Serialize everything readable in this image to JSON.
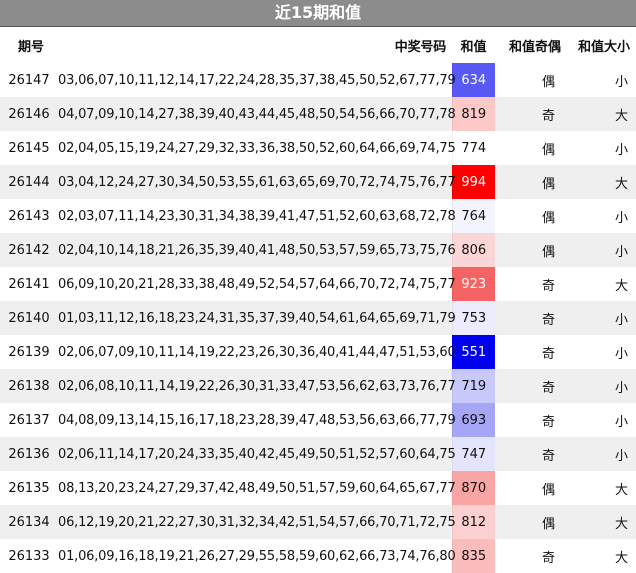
{
  "title": "近15期和值",
  "headers": {
    "issue": "期号",
    "numbers": "中奖号码",
    "sum": "和值",
    "odd_even": "和值奇偶",
    "big_small": "和值大小"
  },
  "colors": {
    "title_bg": "#8c8c8c",
    "low_extreme": "#0000ee",
    "high_extreme": "#ff0000"
  },
  "rows": [
    {
      "issue": "26147",
      "numbers": "03,06,07,10,11,12,14,17,22,24,28,35,37,38,45,50,52,67,77,79",
      "sum": "634",
      "odd_even": "偶",
      "big_small": "小",
      "sum_bg": "#5858f4",
      "sum_color": "#ffffff"
    },
    {
      "issue": "26146",
      "numbers": "04,07,09,10,14,27,38,39,40,43,44,45,48,50,54,56,66,70,77,78",
      "sum": "819",
      "odd_even": "奇",
      "big_small": "大",
      "sum_bg": "#fcc8c8",
      "sum_color": "#111111"
    },
    {
      "issue": "26145",
      "numbers": "02,04,05,15,19,24,27,29,32,33,36,38,50,52,60,64,66,69,74,75",
      "sum": "774",
      "odd_even": "偶",
      "big_small": "小",
      "sum_bg": "#ffffff",
      "sum_color": "#111111"
    },
    {
      "issue": "26144",
      "numbers": "03,04,12,24,27,30,34,50,53,55,61,63,65,69,70,72,74,75,76,77",
      "sum": "994",
      "odd_even": "偶",
      "big_small": "大",
      "sum_bg": "#ff0000",
      "sum_color": "#ffffff"
    },
    {
      "issue": "26143",
      "numbers": "02,03,07,11,14,23,30,31,34,38,39,41,47,51,52,60,63,68,72,78",
      "sum": "764",
      "odd_even": "偶",
      "big_small": "小",
      "sum_bg": "#f4f4fe",
      "sum_color": "#111111"
    },
    {
      "issue": "26142",
      "numbers": "02,04,10,14,18,21,26,35,39,40,41,48,50,53,57,59,65,73,75,76",
      "sum": "806",
      "odd_even": "偶",
      "big_small": "小",
      "sum_bg": "#fcd6d6",
      "sum_color": "#111111"
    },
    {
      "issue": "26141",
      "numbers": "06,09,10,20,21,28,33,38,48,49,52,54,57,64,66,70,72,74,75,77",
      "sum": "923",
      "odd_even": "奇",
      "big_small": "大",
      "sum_bg": "#f56464",
      "sum_color": "#ffffff"
    },
    {
      "issue": "26140",
      "numbers": "01,03,11,12,16,18,23,24,31,35,37,39,40,54,61,64,65,69,71,79",
      "sum": "753",
      "odd_even": "奇",
      "big_small": "小",
      "sum_bg": "#ececfd",
      "sum_color": "#111111"
    },
    {
      "issue": "26139",
      "numbers": "02,06,07,09,10,11,14,19,22,23,26,30,36,40,41,44,47,51,53,60",
      "sum": "551",
      "odd_even": "奇",
      "big_small": "小",
      "sum_bg": "#0000ee",
      "sum_color": "#ffffff"
    },
    {
      "issue": "26138",
      "numbers": "02,06,08,10,11,14,19,22,26,30,31,33,47,53,56,62,63,73,76,77",
      "sum": "719",
      "odd_even": "奇",
      "big_small": "小",
      "sum_bg": "#c8c8fb",
      "sum_color": "#111111"
    },
    {
      "issue": "26137",
      "numbers": "04,08,09,13,14,15,16,17,18,23,28,39,47,48,53,56,63,66,77,79",
      "sum": "693",
      "odd_even": "奇",
      "big_small": "小",
      "sum_bg": "#a6a6f7",
      "sum_color": "#111111"
    },
    {
      "issue": "26136",
      "numbers": "02,06,11,14,17,20,24,33,35,40,42,45,49,50,51,52,57,60,64,75",
      "sum": "747",
      "odd_even": "奇",
      "big_small": "小",
      "sum_bg": "#e4e4fc",
      "sum_color": "#111111"
    },
    {
      "issue": "26135",
      "numbers": "08,13,20,23,24,27,29,37,42,48,49,50,51,57,59,60,64,65,67,77",
      "sum": "870",
      "odd_even": "偶",
      "big_small": "大",
      "sum_bg": "#f9a5a5",
      "sum_color": "#111111"
    },
    {
      "issue": "26134",
      "numbers": "06,12,19,20,21,22,27,30,31,32,34,42,51,54,57,66,70,71,72,75",
      "sum": "812",
      "odd_even": "偶",
      "big_small": "大",
      "sum_bg": "#fcd0d0",
      "sum_color": "#111111"
    },
    {
      "issue": "26133",
      "numbers": "01,06,09,16,18,19,21,26,27,29,55,58,59,60,62,66,73,74,76,80",
      "sum": "835",
      "odd_even": "奇",
      "big_small": "大",
      "sum_bg": "#fbbcbc",
      "sum_color": "#111111"
    }
  ]
}
